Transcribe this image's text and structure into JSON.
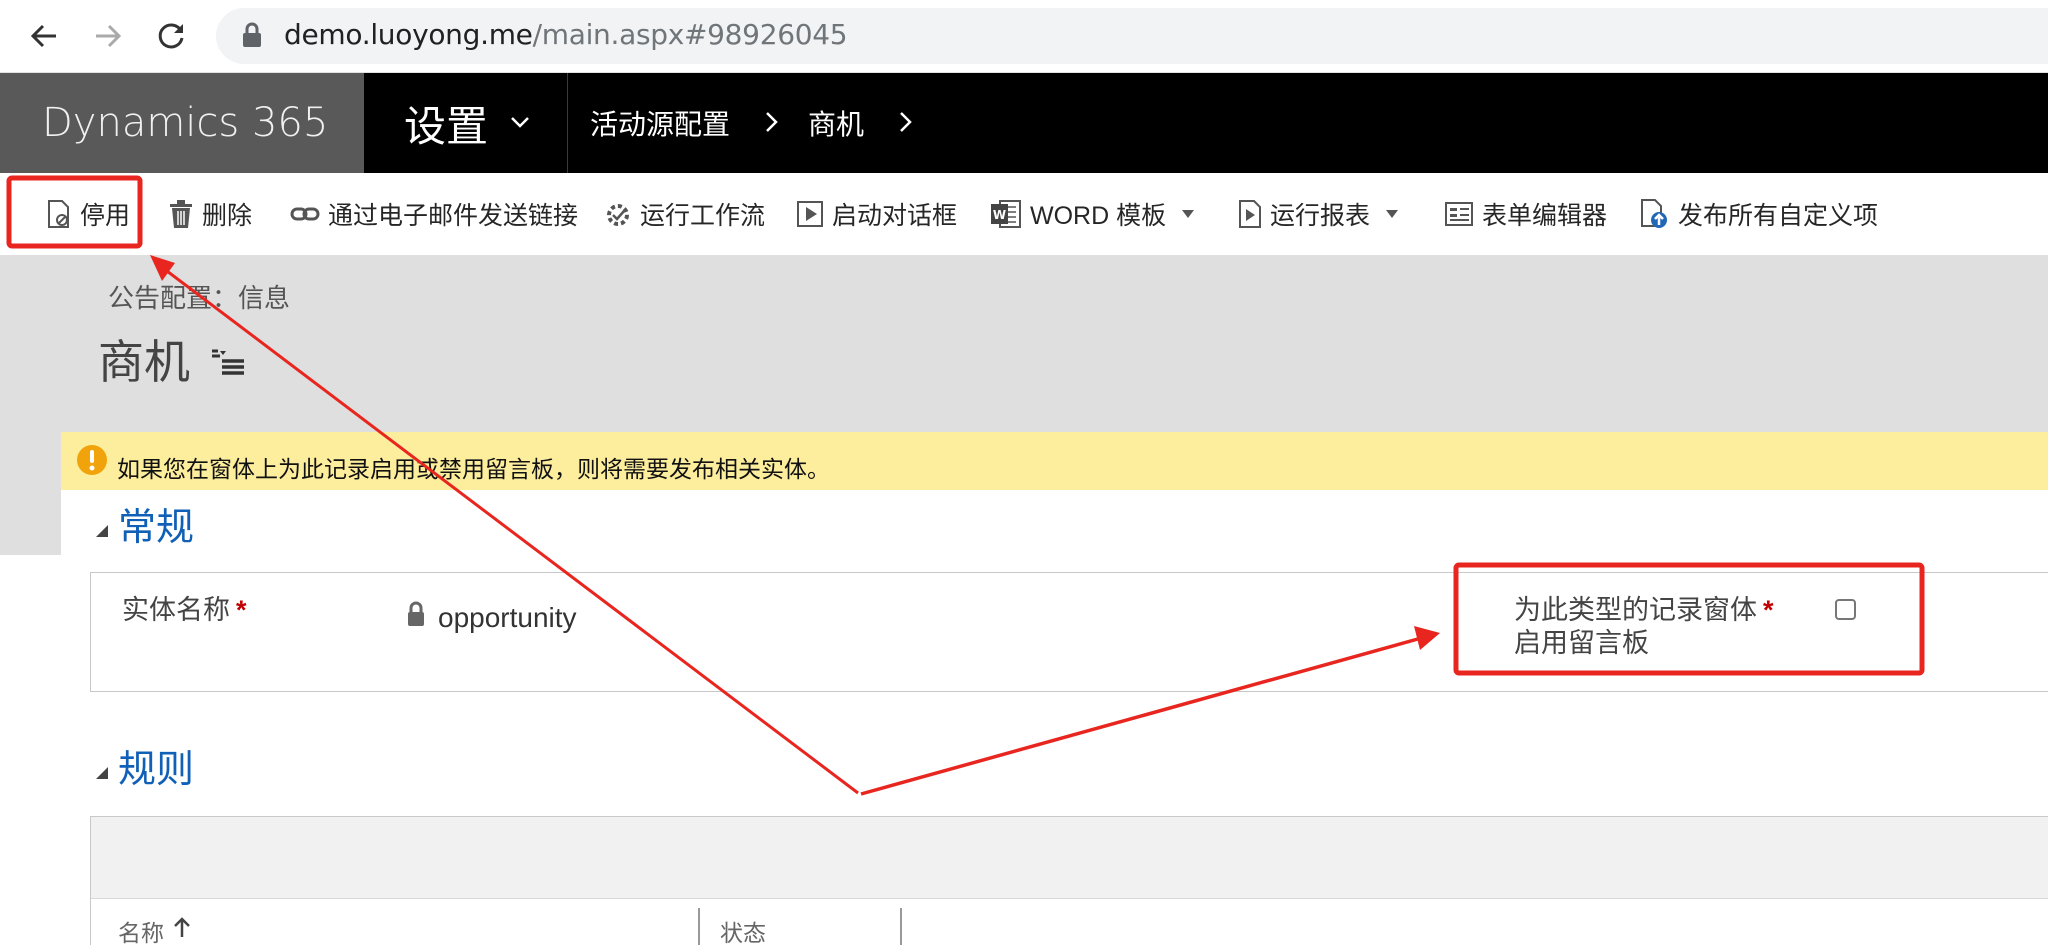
{
  "browser": {
    "url_host": "demo.luoyong.me",
    "url_path": "/main.aspx#98926045"
  },
  "navbar": {
    "brand": "Dynamics 365",
    "area": "设置",
    "breadcrumbs": [
      "活动源配置",
      "商机"
    ]
  },
  "commandbar": {
    "items": [
      {
        "label": "停用",
        "icon": "deactivate-icon"
      },
      {
        "label": "删除",
        "icon": "trash-icon"
      },
      {
        "label": "通过电子邮件发送链接",
        "icon": "link-icon"
      },
      {
        "label": "运行工作流",
        "icon": "workflow-icon"
      },
      {
        "label": "启动对话框",
        "icon": "dialog-icon"
      },
      {
        "label": "WORD 模板",
        "icon": "word-icon"
      },
      {
        "label": "运行报表",
        "icon": "report-icon"
      },
      {
        "label": "表单编辑器",
        "icon": "form-editor-icon"
      },
      {
        "label": "发布所有自定义项",
        "icon": "publish-icon"
      }
    ]
  },
  "header": {
    "form_label": "公告配置：信息",
    "title": "商机"
  },
  "notice": {
    "text": "如果您在窗体上为此记录启用或禁用留言板，则将需要发布相关实体。",
    "color": "#fdee9e"
  },
  "sections": {
    "general": {
      "title": "常规",
      "entity_name_label": "实体名称",
      "entity_name_value": "opportunity",
      "wall_label_line1": "为此类型的记录窗体",
      "wall_label_line2": "启用留言板",
      "wall_checked": false,
      "required_mark": "*"
    },
    "rules": {
      "title": "规则",
      "columns": [
        "名称",
        "状态"
      ]
    }
  },
  "colors": {
    "accent_blue": "#1160b7",
    "annotation_red": "#e8261f",
    "nav_black": "#000000",
    "brand_gray": "#595959"
  }
}
